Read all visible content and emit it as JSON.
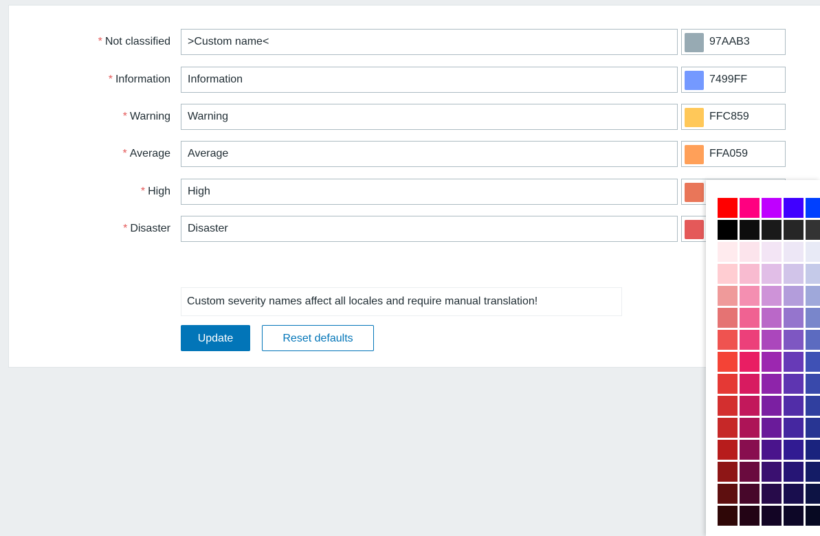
{
  "severities": [
    {
      "label": "Not classified",
      "value": ">Custom name<",
      "hex": "97AAB3",
      "color": "#97AAB3"
    },
    {
      "label": "Information",
      "value": "Information",
      "hex": "7499FF",
      "color": "#7499FF"
    },
    {
      "label": "Warning",
      "value": "Warning",
      "hex": "FFC859",
      "color": "#FFC859"
    },
    {
      "label": "Average",
      "value": "Average",
      "hex": "FFA059",
      "color": "#FFA059"
    },
    {
      "label": "High",
      "value": "High",
      "hex": "",
      "color": "#E97659"
    },
    {
      "label": "Disaster",
      "value": "Disaster",
      "hex": "",
      "color": "#E45959"
    }
  ],
  "required_marker": "*",
  "notice": "Custom severity names affect all locales and require manual translation!",
  "buttons": {
    "update": "Update",
    "reset": "Reset defaults"
  },
  "palette": {
    "rows": [
      [
        "#ff0000",
        "#ff0080",
        "#bf00ff",
        "#4000ff",
        "#0040ff"
      ],
      [
        "#000000",
        "#0d0d0d",
        "#1a1a1a",
        "#262626",
        "#333333"
      ],
      [
        "#ffebee",
        "#fce4ec",
        "#f3e5f5",
        "#ede7f6",
        "#e8eaf6"
      ],
      [
        "#ffcdd2",
        "#f8bbd0",
        "#e1bee7",
        "#d1c4e9",
        "#c5cae9"
      ],
      [
        "#ef9a9a",
        "#f48fb1",
        "#ce93d8",
        "#b39ddb",
        "#9fa8da"
      ],
      [
        "#e57373",
        "#f06292",
        "#ba68c8",
        "#9575cd",
        "#7986cb"
      ],
      [
        "#ef5350",
        "#ec407a",
        "#ab47bc",
        "#7e57c2",
        "#5c6bc0"
      ],
      [
        "#f44336",
        "#e91e63",
        "#9c27b0",
        "#673ab7",
        "#3f51b5"
      ],
      [
        "#e53935",
        "#d81b60",
        "#8e24aa",
        "#5e35b1",
        "#3949ab"
      ],
      [
        "#d32f2f",
        "#c2185b",
        "#7b1fa2",
        "#512da8",
        "#303f9f"
      ],
      [
        "#c62828",
        "#ad1457",
        "#6a1b9a",
        "#4527a0",
        "#283593"
      ],
      [
        "#b71c1c",
        "#880e4f",
        "#4a148c",
        "#311b92",
        "#1a237e"
      ],
      [
        "#8e1616",
        "#6a0b3e",
        "#3a1070",
        "#261575",
        "#141c66"
      ],
      [
        "#5e0f0f",
        "#47072a",
        "#270b4a",
        "#190e4e",
        "#0d1344"
      ],
      [
        "#2f0707",
        "#230415",
        "#130525",
        "#0d0727",
        "#070922"
      ]
    ]
  }
}
